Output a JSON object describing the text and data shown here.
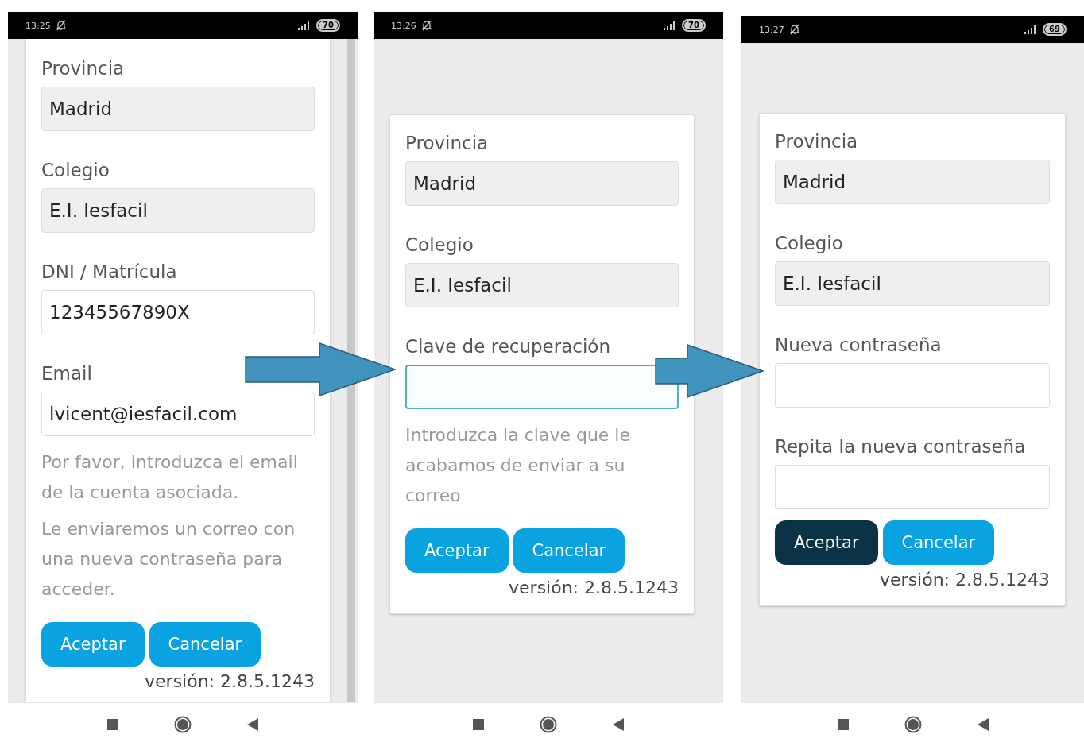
{
  "phones": [
    {
      "status": {
        "time": "13:25",
        "battery": "70"
      },
      "form": {
        "fields": [
          {
            "label": "Provincia",
            "kind": "readonly",
            "value": "Madrid"
          },
          {
            "label": "Colegio",
            "kind": "readonly",
            "value": "E.I. Iesfacil"
          },
          {
            "label": "DNI / Matrícula",
            "kind": "input",
            "value": "12345567890X",
            "focused": false
          },
          {
            "label": "Email",
            "kind": "input",
            "value": "lvicent@iesfacil.com",
            "focused": false
          }
        ],
        "help": [
          "Por favor, introduzca el email de la cuenta asociada.",
          "Le enviaremos un correo con una nueva contraseña para acceder."
        ],
        "buttons": [
          {
            "label": "Aceptar",
            "pressed": false
          },
          {
            "label": "Cancelar",
            "pressed": false
          }
        ],
        "version": "versión: 2.8.5.1243"
      }
    },
    {
      "status": {
        "time": "13:26",
        "battery": "70"
      },
      "form": {
        "fields": [
          {
            "label": "Provincia",
            "kind": "readonly",
            "value": "Madrid"
          },
          {
            "label": "Colegio",
            "kind": "readonly",
            "value": "E.I. Iesfacil"
          },
          {
            "label": "Clave de recuperación",
            "kind": "input",
            "focused": true
          }
        ],
        "help": [
          "Introduzca la clave que le acabamos de enviar a su correo"
        ],
        "buttons": [
          {
            "label": "Aceptar",
            "pressed": false
          },
          {
            "label": "Cancelar",
            "pressed": false
          }
        ],
        "version": "versión: 2.8.5.1243"
      }
    },
    {
      "status": {
        "time": "13:27",
        "battery": "69"
      },
      "form": {
        "fields": [
          {
            "label": "Provincia",
            "kind": "readonly",
            "value": "Madrid"
          },
          {
            "label": "Colegio",
            "kind": "readonly",
            "value": "E.I. Iesfacil"
          },
          {
            "label": "Nueva contraseña",
            "kind": "input",
            "focused": false
          },
          {
            "label": "Repita la nueva contraseña",
            "kind": "input",
            "focused": false
          }
        ],
        "buttons": [
          {
            "label": "Aceptar",
            "pressed": true
          },
          {
            "label": "Cancelar",
            "pressed": false
          }
        ],
        "version": "versión: 2.8.5.1243"
      }
    }
  ]
}
